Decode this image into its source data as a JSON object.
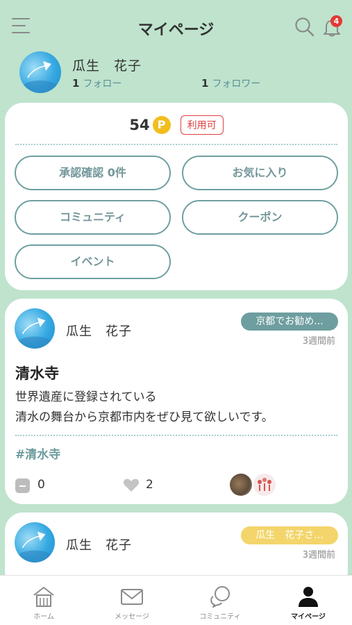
{
  "header": {
    "title": "マイページ",
    "notification_count": "4",
    "icons": [
      "menu-icon",
      "search-icon",
      "bell-icon"
    ]
  },
  "profile": {
    "name": "瓜生　花子",
    "following_count": "1",
    "following_label": "フォロー",
    "followers_count": "1",
    "followers_label": "フォロワー"
  },
  "points": {
    "value": "54",
    "icon_letter": "P",
    "status": "利用可",
    "buttons": {
      "approval": "承認確認 0件",
      "favorites": "お気に入り",
      "community": "コミュニティ",
      "coupon": "クーポン",
      "event": "イベント"
    }
  },
  "posts": [
    {
      "author": "瓜生　花子",
      "tag": "京都でお勧め...",
      "tag_color": "#6e9e9f",
      "time": "3週間前",
      "title": "清水寺",
      "body_line1": "世界遺産に登録されている",
      "body_line2": "清水の舞台から京都市内をぜひ見て欲しいです。",
      "hashtag": "#清水寺",
      "comments": "0",
      "likes": "2"
    },
    {
      "author": "瓜生　花子",
      "tag": "瓜生　花子さ...",
      "tag_color": "#f3d56b",
      "time": "3週間前"
    }
  ],
  "nav": {
    "home": "ホーム",
    "messages": "メッセージ",
    "community": "コミュニティ",
    "mypage": "マイページ"
  },
  "colors": {
    "background": "#bfe3cd",
    "accent": "#6e9e9f",
    "points_gold": "#f2be1f",
    "badge_red": "#e53935"
  }
}
